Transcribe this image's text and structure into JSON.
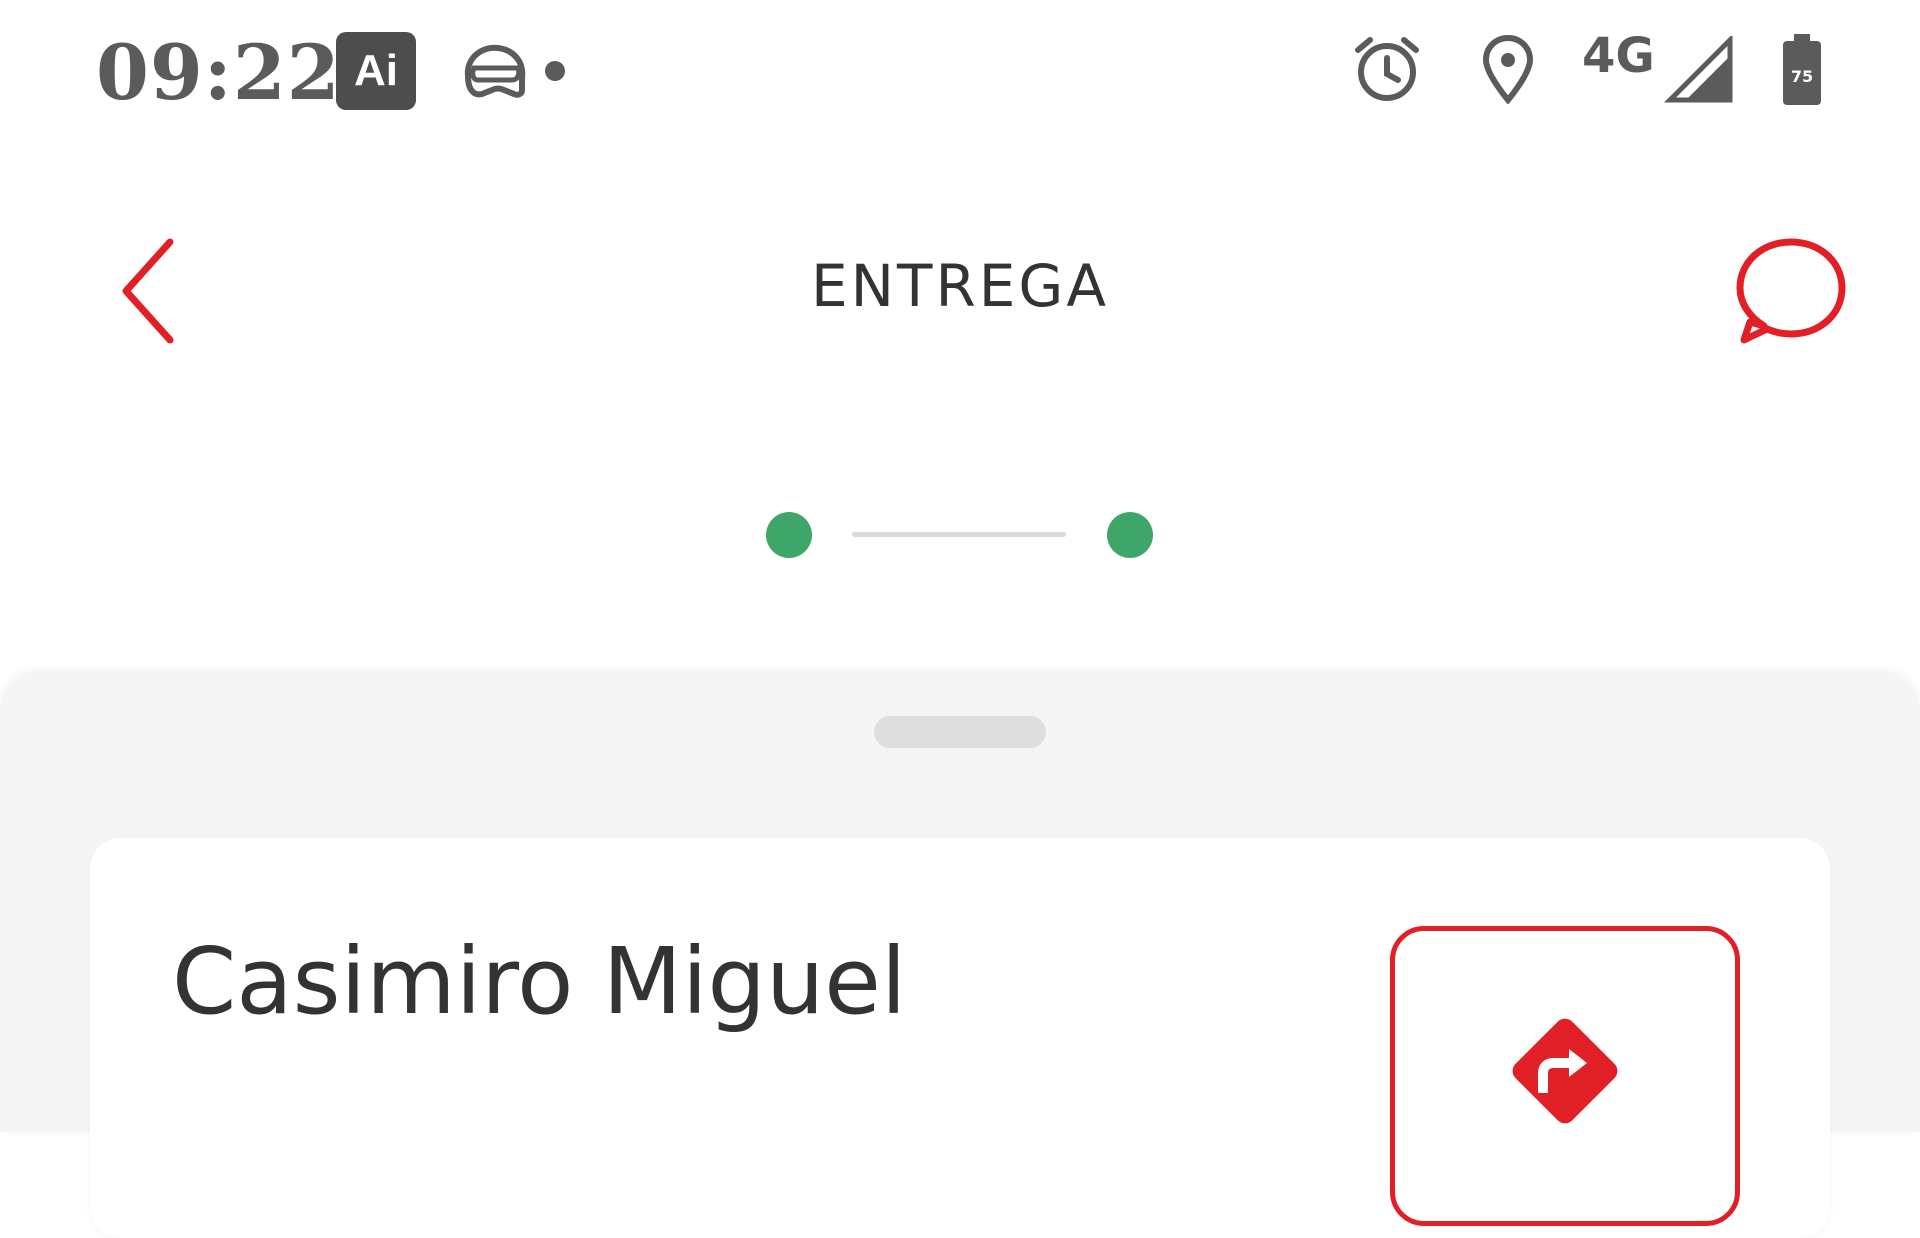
{
  "status_bar": {
    "time": "09:22",
    "app_badge": "Ai",
    "network": "4G",
    "battery_level": "75",
    "icons": [
      "ai-app-icon",
      "helmet-icon",
      "notification-dot-icon",
      "alarm-icon",
      "location-pin-icon",
      "signal-icon",
      "battery-icon"
    ]
  },
  "header": {
    "title": "ENTREGA",
    "back_icon": "chevron-left-icon",
    "chat_icon": "chat-bubble-icon"
  },
  "stepper": {
    "steps_total": 2,
    "steps_completed": 2
  },
  "delivery_card": {
    "customer_name": "Casimiro Miguel",
    "navigate_icon": "directions-icon"
  },
  "colors": {
    "accent": "#e01f27",
    "success": "#3fa66a",
    "text": "#333333",
    "sheet_bg": "#f5f5f5"
  }
}
